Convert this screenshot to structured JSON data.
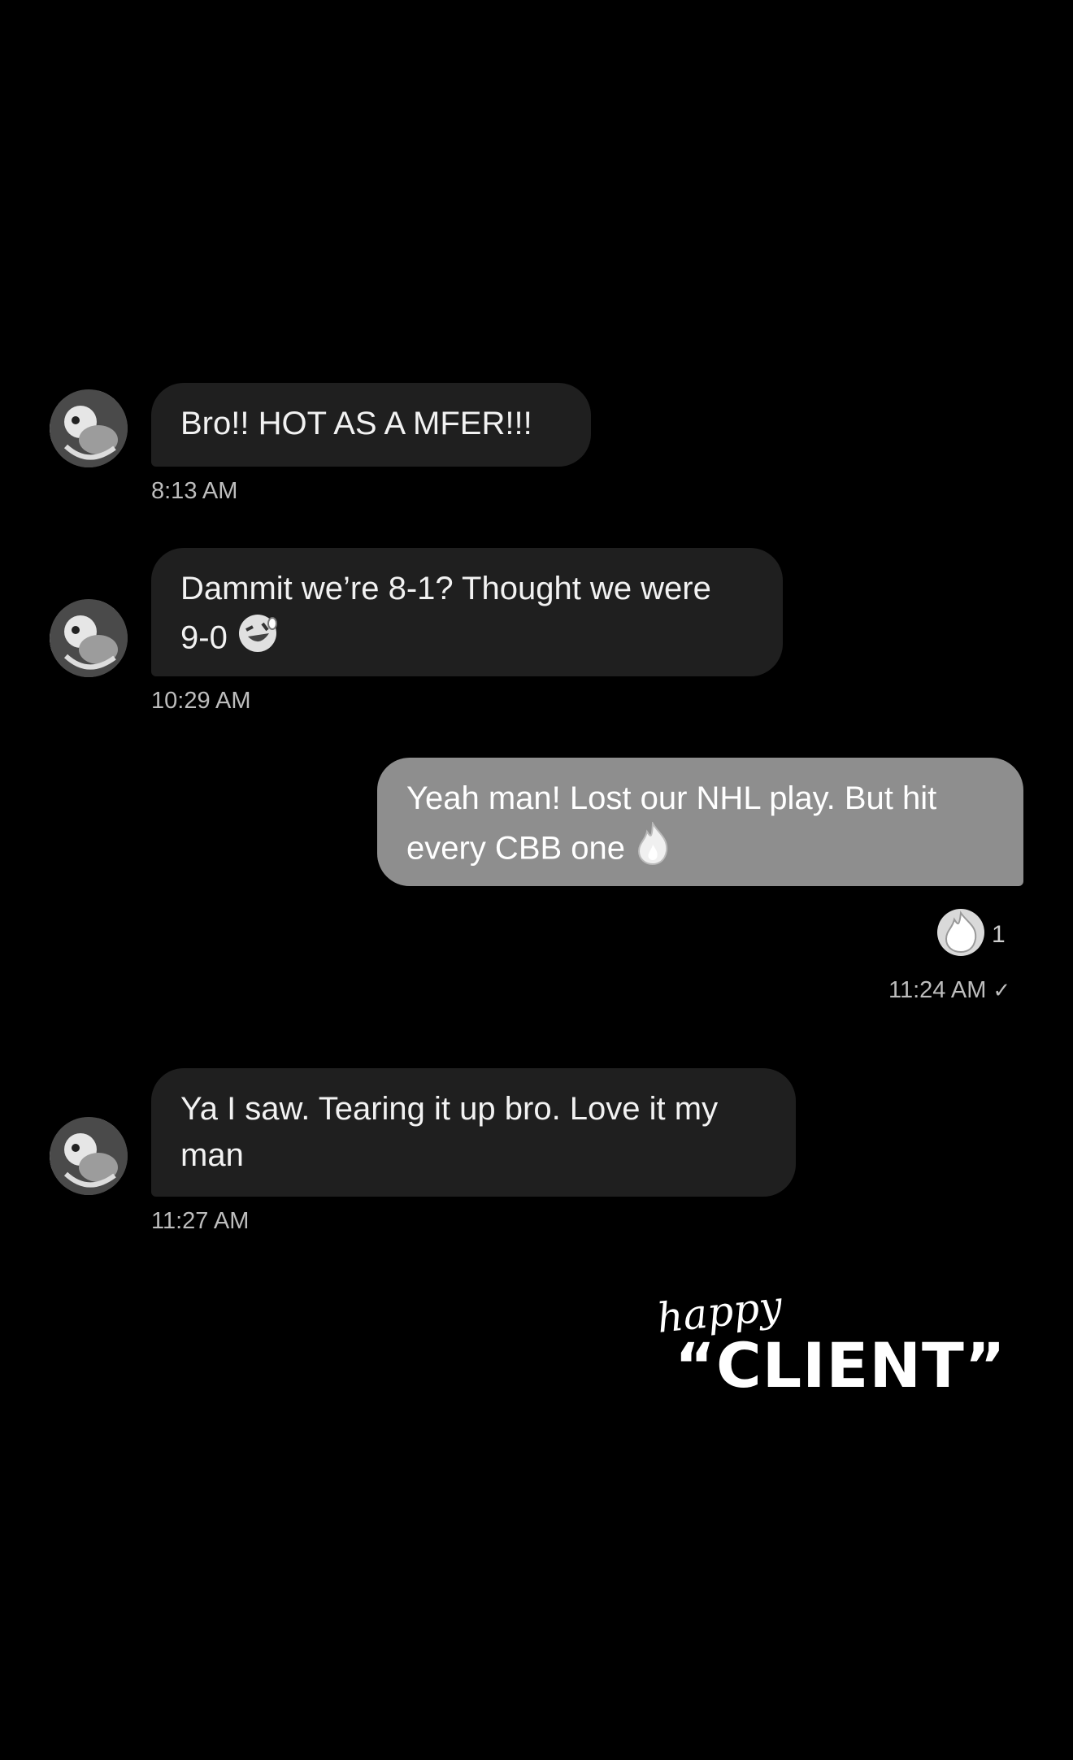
{
  "messages": [
    {
      "direction": "in",
      "text": "Bro!! HOT AS A MFER!!!",
      "time": "8:13 AM"
    },
    {
      "direction": "in",
      "text_line1": "Dammit we’re 8-1? Thought we were",
      "text_line2": "9-0",
      "emoji": "rolling-on-floor-laughing-icon",
      "time": "10:29 AM"
    },
    {
      "direction": "out",
      "text_line1": "Yeah man! Lost our NHL play. But hit",
      "text_line2": "every CBB one",
      "emoji": "fire-icon",
      "reaction": {
        "icon": "fire-icon",
        "count": "1"
      },
      "time": "11:24 AM",
      "status": "✓"
    },
    {
      "direction": "in",
      "text_line1": "Ya I saw. Tearing it up bro. Love it my",
      "text_line2": "man",
      "time": "11:27 AM"
    }
  ],
  "brand": {
    "happy": "happy",
    "client": "“CLIENT”"
  }
}
